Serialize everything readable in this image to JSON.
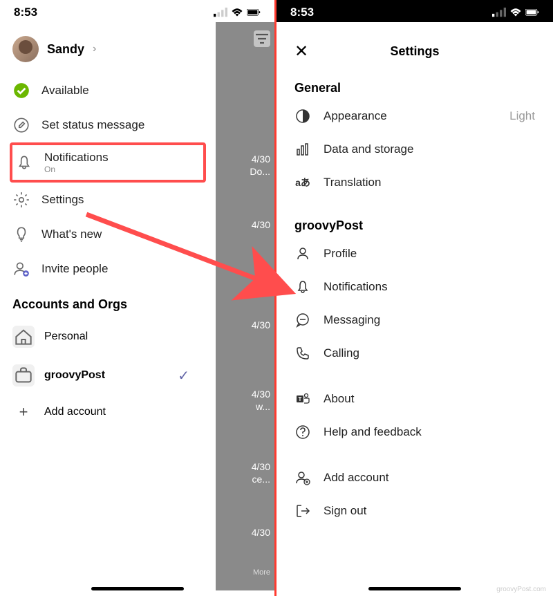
{
  "left": {
    "time": "8:53",
    "profile_name": "Sandy",
    "menu": {
      "available": "Available",
      "status_message": "Set status message",
      "notifications": {
        "label": "Notifications",
        "sublabel": "On"
      },
      "settings": "Settings",
      "whats_new": "What's new",
      "invite": "Invite people"
    },
    "accounts_header": "Accounts and Orgs",
    "accounts": {
      "personal": "Personal",
      "groovypost": "groovyPost",
      "add": "Add account"
    },
    "backdrop": {
      "d1": "4/30",
      "d1b": "Do...",
      "d2": "4/30",
      "d3": "4/30",
      "d4": "4/30",
      "d4b": "w...",
      "d5": "4/30",
      "d5b": "ce...",
      "d6": "4/30",
      "more": "More"
    }
  },
  "right": {
    "time": "8:53",
    "title": "Settings",
    "sections": {
      "general": {
        "title": "General",
        "appearance": {
          "label": "Appearance",
          "value": "Light"
        },
        "data_storage": "Data and storage",
        "translation": "Translation"
      },
      "org": {
        "title": "groovyPost",
        "profile": "Profile",
        "notifications": "Notifications",
        "messaging": "Messaging",
        "calling": "Calling"
      },
      "other": {
        "about": "About",
        "help": "Help and feedback"
      },
      "account": {
        "add": "Add account",
        "signout": "Sign out"
      }
    }
  },
  "watermark": "groovyPost.com"
}
